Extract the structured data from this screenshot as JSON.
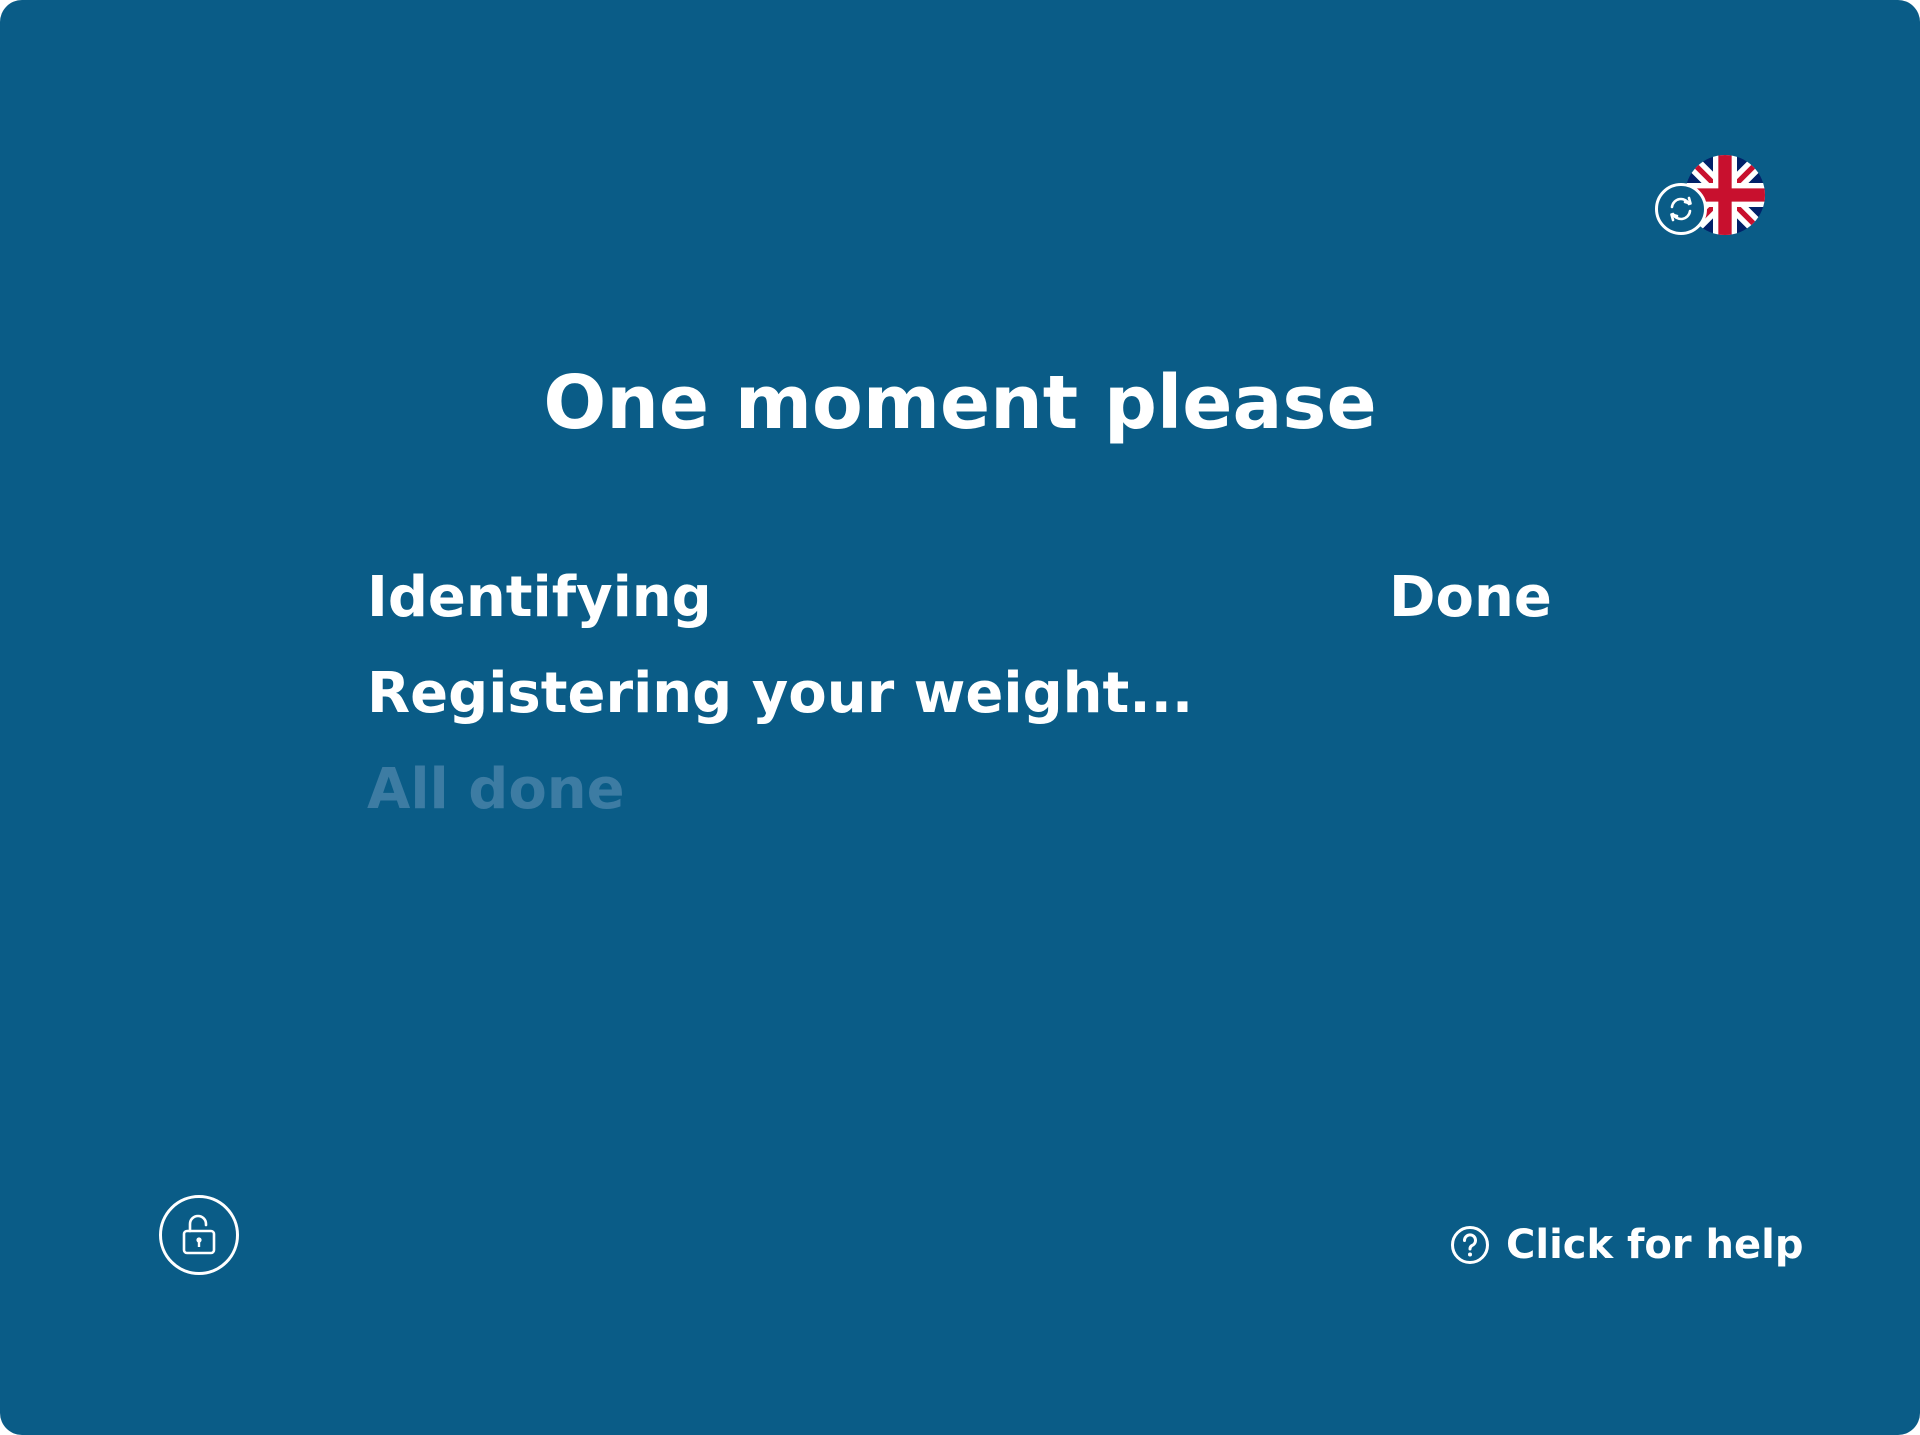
{
  "colors": {
    "background": "#0a5c87",
    "text": "#ffffff",
    "pending_text": "#3d7ca3",
    "flag_blue": "#012169",
    "flag_red": "#C8102E"
  },
  "language": {
    "current": "English (UK)",
    "flag_icon": "uk-flag-icon",
    "switch_icon": "refresh-icon"
  },
  "title": "One moment please",
  "steps": [
    {
      "label": "Identifying",
      "state": "Done",
      "status": "complete"
    },
    {
      "label": "Registering your weight...",
      "state": "",
      "status": "active"
    },
    {
      "label": "All done",
      "state": "",
      "status": "pending"
    }
  ],
  "footer": {
    "unlock_icon": "unlock-icon",
    "help_icon": "question-circle-icon",
    "help_label": "Click for help"
  }
}
